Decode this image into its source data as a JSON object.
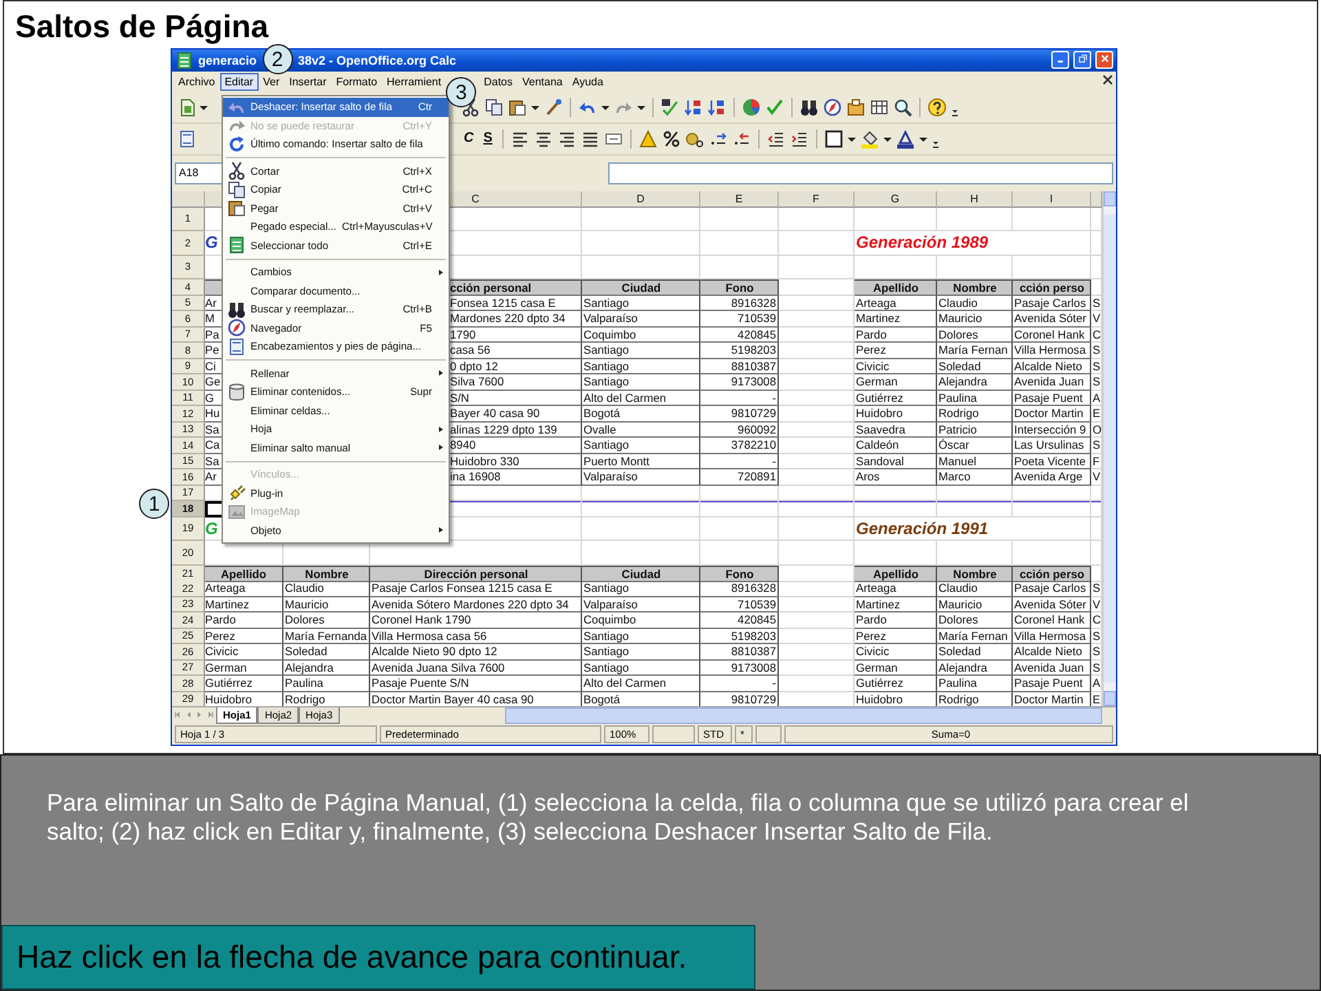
{
  "slide_title": "Saltos de Página",
  "window": {
    "title_parts": [
      "generacio",
      "38v2 - OpenOffice.org Calc"
    ]
  },
  "callouts": [
    "1",
    "2",
    "3"
  ],
  "menubar": [
    {
      "label": "Archivo",
      "selected": false
    },
    {
      "label": "Editar",
      "selected": true
    },
    {
      "label": "Ver",
      "selected": false
    },
    {
      "label": "Insertar",
      "selected": false
    },
    {
      "label": "Formato",
      "selected": false
    },
    {
      "label": "Herramient",
      "selected": false
    },
    {
      "label": "Datos",
      "selected": false
    },
    {
      "label": "Ventana",
      "selected": false
    },
    {
      "label": "Ayuda",
      "selected": false
    }
  ],
  "format_buttons": [
    {
      "label": "C",
      "kind": "italic"
    },
    {
      "label": "S",
      "kind": "underline"
    }
  ],
  "name_box": "A18",
  "edit_menu": [
    {
      "kind": "item",
      "label": "Deshacer: Insertar salto de fila",
      "shortcut": "Ctr",
      "selected": true,
      "disabled": false,
      "submenu": false
    },
    {
      "kind": "item",
      "label": "No se puede restaurar",
      "shortcut": "Ctrl+Y",
      "selected": false,
      "disabled": true,
      "submenu": false
    },
    {
      "kind": "item",
      "label": "Último comando: Insertar salto de fila",
      "selected": false,
      "disabled": false,
      "submenu": false
    },
    {
      "kind": "separator"
    },
    {
      "kind": "item",
      "label": "Cortar",
      "shortcut": "Ctrl+X",
      "selected": false,
      "disabled": false,
      "submenu": false
    },
    {
      "kind": "item",
      "label": "Copiar",
      "shortcut": "Ctrl+C",
      "selected": false,
      "disabled": false,
      "submenu": false
    },
    {
      "kind": "item",
      "label": "Pegar",
      "shortcut": "Ctrl+V",
      "selected": false,
      "disabled": false,
      "submenu": false
    },
    {
      "kind": "item",
      "label": "Pegado especial...",
      "shortcut": "Ctrl+Mayusculas+V",
      "selected": false,
      "disabled": false,
      "submenu": false
    },
    {
      "kind": "item",
      "label": "Seleccionar todo",
      "shortcut": "Ctrl+E",
      "selected": false,
      "disabled": false,
      "submenu": false
    },
    {
      "kind": "separator"
    },
    {
      "kind": "item",
      "label": "Cambios",
      "selected": false,
      "disabled": false,
      "submenu": true
    },
    {
      "kind": "item",
      "label": "Comparar documento...",
      "selected": false,
      "disabled": false,
      "submenu": false
    },
    {
      "kind": "item",
      "label": "Buscar y reemplazar...",
      "shortcut": "Ctrl+B",
      "selected": false,
      "disabled": false,
      "submenu": false
    },
    {
      "kind": "item",
      "label": "Navegador",
      "shortcut": "F5",
      "selected": false,
      "disabled": false,
      "submenu": false
    },
    {
      "kind": "item",
      "label": "Encabezamientos y pies de página...",
      "selected": false,
      "disabled": false,
      "submenu": false
    },
    {
      "kind": "separator"
    },
    {
      "kind": "item",
      "label": "Rellenar",
      "selected": false,
      "disabled": false,
      "submenu": true
    },
    {
      "kind": "item",
      "label": "Eliminar contenidos...",
      "shortcut": "Supr",
      "selected": false,
      "disabled": false,
      "submenu": false
    },
    {
      "kind": "item",
      "label": "Eliminar celdas...",
      "selected": false,
      "disabled": false,
      "submenu": false
    },
    {
      "kind": "item",
      "label": "Hoja",
      "selected": false,
      "disabled": false,
      "submenu": true
    },
    {
      "kind": "item",
      "label": "Eliminar salto manual",
      "selected": false,
      "disabled": false,
      "submenu": true
    },
    {
      "kind": "separator"
    },
    {
      "kind": "item",
      "label": "Vínculos...",
      "selected": false,
      "disabled": true,
      "submenu": false
    },
    {
      "kind": "item",
      "label": "Plug-in",
      "selected": false,
      "disabled": false,
      "submenu": false
    },
    {
      "kind": "item",
      "label": "ImageMap",
      "selected": false,
      "disabled": true,
      "submenu": false
    },
    {
      "kind": "item",
      "label": "Objeto",
      "selected": false,
      "disabled": false,
      "submenu": true
    }
  ],
  "sheet": {
    "column_headers": [
      "C",
      "D",
      "E",
      "F",
      "G",
      "H",
      "I"
    ],
    "rows": [
      {
        "num": "1",
        "kind": "spacer",
        "selected": false,
        "page_break": false
      },
      {
        "num": "2",
        "kind": "title",
        "selected": false,
        "page_break": false,
        "cells": {
          "A": {
            "text": "G",
            "color": "#2b3fbf"
          },
          "G": {
            "text": "Generación 1989",
            "color": "#e3141c"
          }
        }
      },
      {
        "num": "3",
        "kind": "spacer",
        "selected": false,
        "page_break": false
      },
      {
        "num": "4",
        "kind": "header",
        "selected": false,
        "page_break": false,
        "cells": {
          "C": "cción personal",
          "D": "Ciudad",
          "E": "Fono",
          "G": "Apellido",
          "H": "Nombre",
          "I": "cción perso"
        }
      },
      {
        "num": "5",
        "kind": "data",
        "selected": false,
        "page_break": false,
        "cells": {
          "A": "Ar",
          "C": "Fonsea 1215 casa E",
          "D": "Santiago",
          "E": "8916328",
          "G": "Arteaga",
          "H": "Claudio",
          "I": "Pasaje Carlos",
          "J": "S"
        }
      },
      {
        "num": "6",
        "kind": "data",
        "selected": false,
        "page_break": false,
        "cells": {
          "A": "M",
          "C": "Mardones 220 dpto 34",
          "D": "Valparaíso",
          "E": "710539",
          "G": "Martinez",
          "H": "Mauricio",
          "I": "Avenida Sóter",
          "J": "V"
        }
      },
      {
        "num": "7",
        "kind": "data",
        "selected": false,
        "page_break": false,
        "cells": {
          "A": "Pa",
          "C": "1790",
          "D": "Coquimbo",
          "E": "420845",
          "G": "Pardo",
          "H": "Dolores",
          "I": "Coronel Hank",
          "J": "C"
        }
      },
      {
        "num": "8",
        "kind": "data",
        "selected": false,
        "page_break": false,
        "cells": {
          "A": "Pe",
          "C": "casa 56",
          "D": "Santiago",
          "E": "5198203",
          "G": "Perez",
          "H": "María Fernan",
          "I": "Villa Hermosa",
          "J": "S"
        }
      },
      {
        "num": "9",
        "kind": "data",
        "selected": false,
        "page_break": false,
        "cells": {
          "A": "Ci",
          "C": "0 dpto 12",
          "D": "Santiago",
          "E": "8810387",
          "G": "Civicic",
          "H": "Soledad",
          "I": "Alcalde Nieto",
          "J": "S"
        }
      },
      {
        "num": "10",
        "kind": "data",
        "selected": false,
        "page_break": false,
        "cells": {
          "A": "Ge",
          "C": "Silva 7600",
          "D": "Santiago",
          "E": "9173008",
          "G": "German",
          "H": "Alejandra",
          "I": "Avenida Juan",
          "J": "S"
        }
      },
      {
        "num": "11",
        "kind": "data",
        "selected": false,
        "page_break": false,
        "cells": {
          "A": "G",
          "C": "S/N",
          "D": "Alto del Carmen",
          "E": "-",
          "G": "Gutiérrez",
          "H": "Paulina",
          "I": "Pasaje Puent",
          "J": "A"
        }
      },
      {
        "num": "12",
        "kind": "data",
        "selected": false,
        "page_break": false,
        "cells": {
          "A": "Hu",
          "C": "Bayer 40 casa 90",
          "D": "Bogotá",
          "E": "9810729",
          "G": "Huidobro",
          "H": "Rodrigo",
          "I": "Doctor Martin",
          "J": "E"
        }
      },
      {
        "num": "13",
        "kind": "data",
        "selected": false,
        "page_break": false,
        "cells": {
          "A": "Sa",
          "C": "alinas 1229 dpto 139",
          "D": "Ovalle",
          "E": "960092",
          "G": "Saavedra",
          "H": "Patricio",
          "I": "Intersección 9",
          "J": "O"
        }
      },
      {
        "num": "14",
        "kind": "data",
        "selected": false,
        "page_break": false,
        "cells": {
          "A": "Ca",
          "C": "8940",
          "D": "Santiago",
          "E": "3782210",
          "G": "Caldeón",
          "H": "Óscar",
          "I": "Las Ursulinas",
          "J": "S"
        }
      },
      {
        "num": "15",
        "kind": "data",
        "selected": false,
        "page_break": false,
        "cells": {
          "A": "Sa",
          "C": "Huidobro 330",
          "D": "Puerto Montt",
          "E": "-",
          "G": "Sandoval",
          "H": "Manuel",
          "I": "Poeta Vicente",
          "J": "F"
        }
      },
      {
        "num": "16",
        "kind": "data",
        "selected": false,
        "page_break": false,
        "cells": {
          "A": "Ar",
          "C": "ina 16908",
          "D": "Valparaíso",
          "E": "720891",
          "G": "Aros",
          "H": "Marco",
          "I": "Avenida Arge",
          "J": "V"
        }
      },
      {
        "num": "17",
        "kind": "blank",
        "selected": false,
        "page_break": true
      },
      {
        "num": "18",
        "kind": "blank",
        "selected": true,
        "page_break": false
      },
      {
        "num": "19",
        "kind": "title",
        "selected": false,
        "page_break": false,
        "cells": {
          "A": {
            "text": "G",
            "color": "#1fa83a"
          },
          "G": {
            "text": "Generación 1991",
            "color": "#7a3b0c"
          }
        }
      },
      {
        "num": "20",
        "kind": "spacer",
        "selected": false,
        "page_break": false
      },
      {
        "num": "21",
        "kind": "header",
        "selected": false,
        "page_break": false,
        "cells": {
          "A": "Apellido",
          "B": "Nombre",
          "C": "Dirección personal",
          "D": "Ciudad",
          "E": "Fono",
          "G": "Apellido",
          "H": "Nombre",
          "I": "cción perso"
        }
      },
      {
        "num": "22",
        "kind": "data",
        "selected": false,
        "page_break": false,
        "cells": {
          "A": "Arteaga",
          "B": "Claudio",
          "C": "Pasaje Carlos Fonsea 1215 casa E",
          "D": "Santiago",
          "E": "8916328",
          "G": "Arteaga",
          "H": "Claudio",
          "I": "Pasaje Carlos",
          "J": "S"
        }
      },
      {
        "num": "23",
        "kind": "data",
        "selected": false,
        "page_break": false,
        "cells": {
          "A": "Martinez",
          "B": "Mauricio",
          "C": "Avenida Sótero Mardones 220 dpto 34",
          "D": "Valparaíso",
          "E": "710539",
          "G": "Martinez",
          "H": "Mauricio",
          "I": "Avenida Sóter",
          "J": "V"
        }
      },
      {
        "num": "24",
        "kind": "data",
        "selected": false,
        "page_break": false,
        "cells": {
          "A": "Pardo",
          "B": "Dolores",
          "C": "Coronel Hank 1790",
          "D": "Coquimbo",
          "E": "420845",
          "G": "Pardo",
          "H": "Dolores",
          "I": "Coronel Hank",
          "J": "C"
        }
      },
      {
        "num": "25",
        "kind": "data",
        "selected": false,
        "page_break": false,
        "cells": {
          "A": "Perez",
          "B": "María Fernanda",
          "C": "Villa Hermosa casa 56",
          "D": "Santiago",
          "E": "5198203",
          "G": "Perez",
          "H": "María Fernan",
          "I": "Villa Hermosa",
          "J": "S"
        }
      },
      {
        "num": "26",
        "kind": "data",
        "selected": false,
        "page_break": false,
        "cells": {
          "A": "Civicic",
          "B": "Soledad",
          "C": "Alcalde Nieto 90 dpto 12",
          "D": "Santiago",
          "E": "8810387",
          "G": "Civicic",
          "H": "Soledad",
          "I": "Alcalde Nieto",
          "J": "S"
        }
      },
      {
        "num": "27",
        "kind": "data",
        "selected": false,
        "page_break": false,
        "cells": {
          "A": "German",
          "B": "Alejandra",
          "C": "Avenida Juana Silva 7600",
          "D": "Santiago",
          "E": "9173008",
          "G": "German",
          "H": "Alejandra",
          "I": "Avenida Juan",
          "J": "S"
        }
      },
      {
        "num": "28",
        "kind": "data",
        "selected": false,
        "page_break": false,
        "cells": {
          "A": "Gutiérrez",
          "B": "Paulina",
          "C": "Pasaje Puente S/N",
          "D": "Alto del Carmen",
          "E": "-",
          "G": "Gutiérrez",
          "H": "Paulina",
          "I": "Pasaje Puent",
          "J": "A"
        }
      },
      {
        "num": "29",
        "kind": "data",
        "selected": false,
        "page_break": false,
        "cells": {
          "A": "Huidobro",
          "B": "Rodrigo",
          "C": "Doctor Martin Bayer 40 casa 90",
          "D": "Bogotá",
          "E": "9810729",
          "G": "Huidobro",
          "H": "Rodrigo",
          "I": "Doctor Martin",
          "J": "E"
        }
      }
    ]
  },
  "sheet_tabs": [
    {
      "label": "Hoja1",
      "selected": true
    },
    {
      "label": "Hoja2",
      "selected": false
    },
    {
      "label": "Hoja3",
      "selected": false
    }
  ],
  "status_bar": {
    "sheet": "Hoja 1 / 3",
    "style": "Predeterminado",
    "zoom": "100%",
    "mode": "STD",
    "modified": "*",
    "sum": "Suma=0"
  },
  "instructions": "Para eliminar un Salto de Página Manual, (1) selecciona la celda, fila o columna que se utilizó para crear el salto; (2) haz click en Editar y, finalmente, (3) selecciona Deshacer Insertar Salto de Fila.",
  "continue_hint": "Haz click en la flecha de avance para continuar."
}
